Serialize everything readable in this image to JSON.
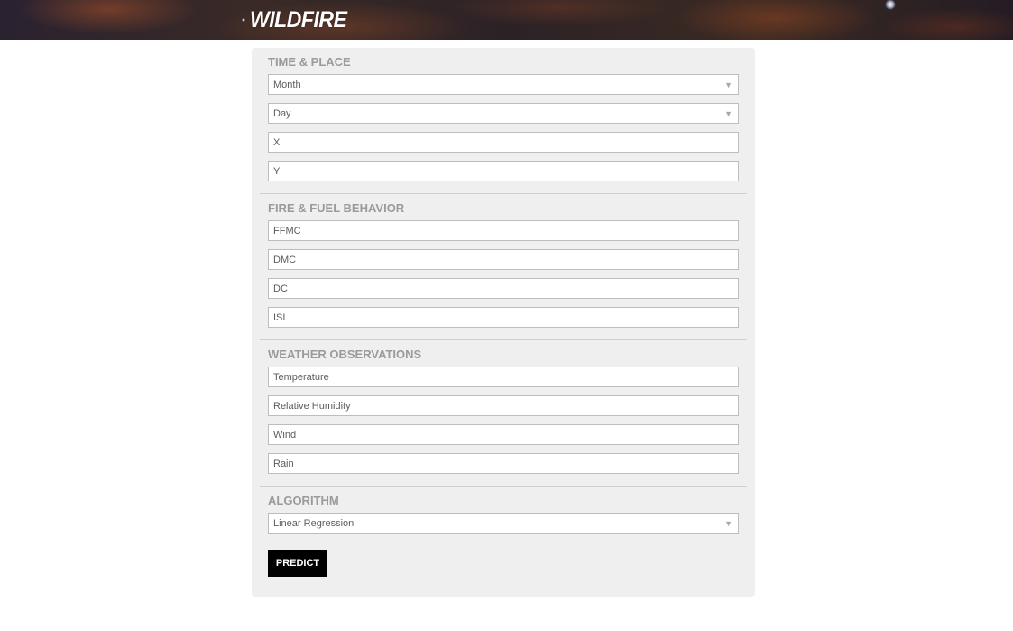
{
  "header": {
    "logo_text": "WILDFIRE"
  },
  "sections": {
    "time_place": {
      "title": "TIME & PLACE",
      "month": {
        "value": "Month",
        "icon": "caret-down-icon"
      },
      "day": {
        "value": "Day",
        "icon": "caret-down-icon"
      },
      "x": {
        "placeholder": "X"
      },
      "y": {
        "placeholder": "Y"
      }
    },
    "fire_fuel": {
      "title": "FIRE & FUEL BEHAVIOR",
      "ffmc": {
        "placeholder": "FFMC"
      },
      "dmc": {
        "placeholder": "DMC"
      },
      "dc": {
        "placeholder": "DC"
      },
      "isi": {
        "placeholder": "ISI"
      }
    },
    "weather": {
      "title": "WEATHER OBSERVATIONS",
      "temperature": {
        "placeholder": "Temperature"
      },
      "humidity": {
        "placeholder": "Relative Humidity"
      },
      "wind": {
        "placeholder": "Wind"
      },
      "rain": {
        "placeholder": "Rain"
      }
    },
    "algorithm": {
      "title": "ALGORITHM",
      "select": {
        "value": "Linear Regression",
        "icon": "caret-down-icon"
      }
    }
  },
  "actions": {
    "predict_label": "PREDICT"
  },
  "colors": {
    "panel_bg": "#efefef",
    "section_title": "#9b9b9b",
    "button_bg": "#000000",
    "button_text": "#ffffff"
  }
}
